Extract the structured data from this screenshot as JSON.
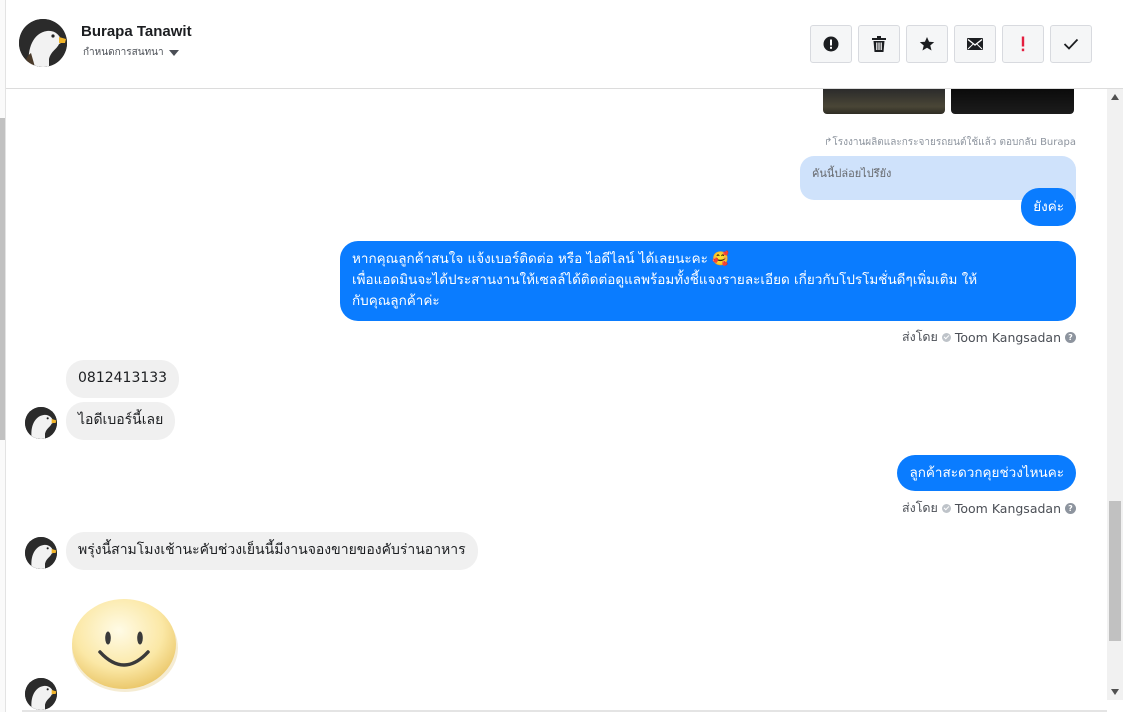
{
  "header": {
    "contact_name": "Burapa Tanawit",
    "assign_label": "กำหนดการสนทนา",
    "avatar_icon": "bald-eagle-avatar"
  },
  "toolbar": {
    "buttons": [
      {
        "name": "alert-icon",
        "glyph": "!",
        "style": "circle"
      },
      {
        "name": "trash-icon",
        "glyph": "🗑"
      },
      {
        "name": "star-icon",
        "glyph": "★"
      },
      {
        "name": "envelope-icon",
        "glyph": "✉"
      },
      {
        "name": "exclamation-icon",
        "glyph": "!",
        "color": "#e41e3f"
      },
      {
        "name": "checkmark-icon",
        "glyph": "✓"
      }
    ]
  },
  "colors": {
    "outgoing_bubble": "#0a7cff",
    "incoming_bubble": "#f0f0f0",
    "quoted_bubble": "#cfe2fb"
  },
  "messages": {
    "reply_note": "↱โรงงานผลิตและกระจายรถยนต์ใช้แล้ว ตอบกลับ Burapa",
    "quoted_text": "คันนี้ปล่อยไปรึยัง",
    "out1": "ยังค่ะ",
    "out2_line1": "หากคุณลูกค้าสนใจ แจ้งเบอร์ติดต่อ หรือ ไอดีไลน์ ได้เลยนะคะ 🥰",
    "out2_line2": "เพื่อแอดมินจะได้ประสานงานให้เซลล์ได้ติดต่อดูแลพร้อมทั้งชี้แจงรายละเอียด เกี่ยวกับโปรโมชั่นดีๆเพิ่มเติม ให้",
    "out2_line3": "กับคุณลูกค้าค่ะ",
    "sent_by_prefix": "ส่งโดย",
    "agent_name": "Toom Kangsadan",
    "in1": "0812413133",
    "in2": "ไอดีเบอร์นี้เลย",
    "out3": "ลูกค้าสะดวกคุยช่วงไหนคะ",
    "in3": "พรุ่งนี้สามโมงเช้านะคับช่วงเย็นนี้มีงานจองขายของคับร่านอาหาร",
    "sticker": "smiley-face-sticker"
  }
}
